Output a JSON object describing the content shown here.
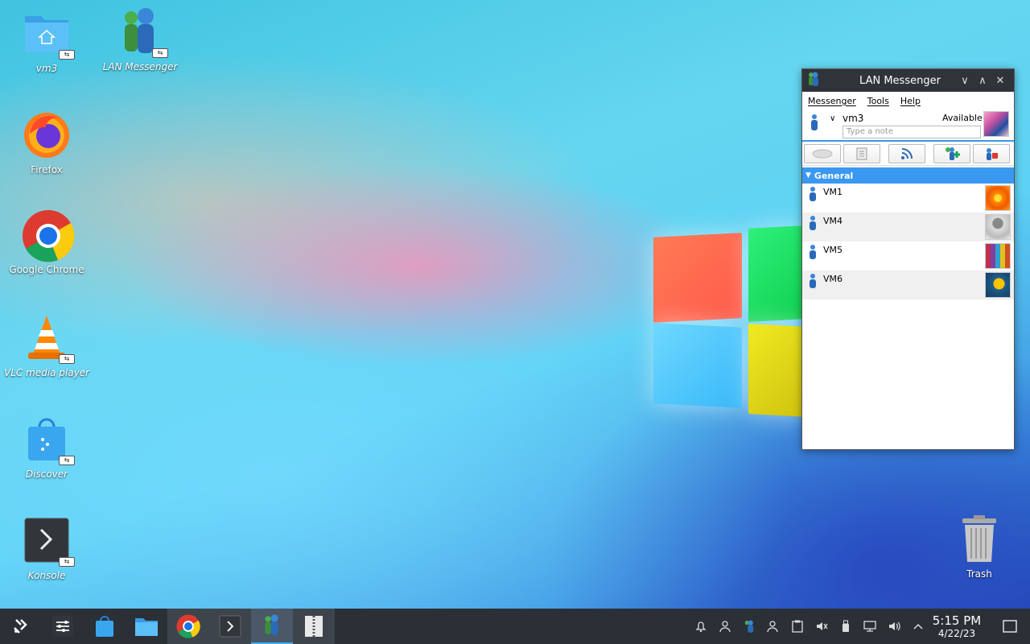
{
  "desktop": {
    "icons": [
      {
        "label": "vm3"
      },
      {
        "label": "LAN Messenger"
      },
      {
        "label": "Firefox"
      },
      {
        "label": "Google Chrome"
      },
      {
        "label": "VLC media player"
      },
      {
        "label": "Discover"
      },
      {
        "label": "Konsole"
      }
    ],
    "trash_label": "Trash"
  },
  "messenger": {
    "title": "LAN Messenger",
    "menu": [
      "Messenger",
      "Tools",
      "Help"
    ],
    "user": {
      "name": "vm3",
      "status": "Available",
      "note_placeholder": "Type a note"
    },
    "group": "General",
    "contacts": [
      {
        "name": "VM1",
        "avatar": "orange-flower"
      },
      {
        "name": "VM4",
        "avatar": "robot"
      },
      {
        "name": "VM5",
        "avatar": "crayons"
      },
      {
        "name": "VM6",
        "avatar": "leaf"
      }
    ]
  },
  "taskbar": {
    "clock_time": "5:15 PM",
    "clock_date": "4/22/23"
  },
  "colors": {
    "accent": "#3a98f0",
    "taskbar": "#2b3036",
    "titlebar": "#2f343b"
  }
}
